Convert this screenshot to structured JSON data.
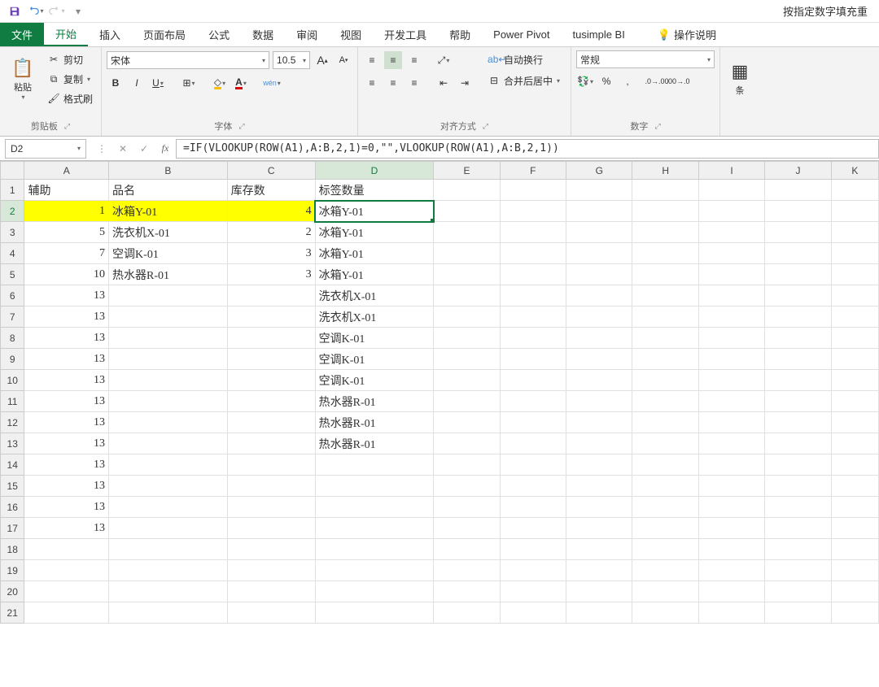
{
  "qat": {
    "title": "按指定数字填充重"
  },
  "tabs": {
    "file": "文件",
    "home": "开始",
    "insert": "插入",
    "layout": "页面布局",
    "formulas": "公式",
    "data": "数据",
    "review": "审阅",
    "view": "视图",
    "dev": "开发工具",
    "help": "帮助",
    "pivot": "Power Pivot",
    "tusimple": "tusimple BI",
    "tell": "操作说明"
  },
  "ribbon": {
    "clipboard": {
      "paste": "粘贴",
      "cut": "剪切",
      "copy": "复制",
      "painter": "格式刷",
      "label": "剪贴板"
    },
    "font": {
      "name": "宋体",
      "size": "10.5",
      "bold": "B",
      "italic": "I",
      "underline": "U",
      "wen": "wén",
      "label": "字体"
    },
    "align": {
      "wrap": "自动换行",
      "merge": "合并后居中",
      "label": "对齐方式"
    },
    "number": {
      "format": "常规",
      "percent": "%",
      "comma": ",",
      "label": "数字"
    },
    "cond": "条"
  },
  "fbar": {
    "cell": "D2",
    "formula": "=IF(VLOOKUP(ROW(A1),A:B,2,1)=0,\"\",VLOOKUP(ROW(A1),A:B,2,1))"
  },
  "columns": [
    "A",
    "B",
    "C",
    "D",
    "E",
    "F",
    "G",
    "H",
    "I",
    "J",
    "K"
  ],
  "row_count": 21,
  "selected": {
    "row": 2,
    "col": "D"
  },
  "highlight_row": 2,
  "highlight_cols": [
    "A",
    "B",
    "C"
  ],
  "cells": {
    "A1": "辅助",
    "B1": "品名",
    "C1": "库存数",
    "D1": "标签数量",
    "A2": "1",
    "B2": "冰箱Y-01",
    "C2": "4",
    "D2": "冰箱Y-01",
    "A3": "5",
    "B3": "洗衣机X-01",
    "C3": "2",
    "D3": "冰箱Y-01",
    "A4": "7",
    "B4": "空调K-01",
    "C4": "3",
    "D4": "冰箱Y-01",
    "A5": "10",
    "B5": "热水器R-01",
    "C5": "3",
    "D5": "冰箱Y-01",
    "A6": "13",
    "D6": "洗衣机X-01",
    "A7": "13",
    "D7": "洗衣机X-01",
    "A8": "13",
    "D8": "空调K-01",
    "A9": "13",
    "D9": "空调K-01",
    "A10": "13",
    "D10": "空调K-01",
    "A11": "13",
    "D11": "热水器R-01",
    "A12": "13",
    "D12": "热水器R-01",
    "A13": "13",
    "D13": "热水器R-01",
    "A14": "13",
    "A15": "13",
    "A16": "13",
    "A17": "13"
  },
  "numeric_cols": [
    "A",
    "C"
  ]
}
